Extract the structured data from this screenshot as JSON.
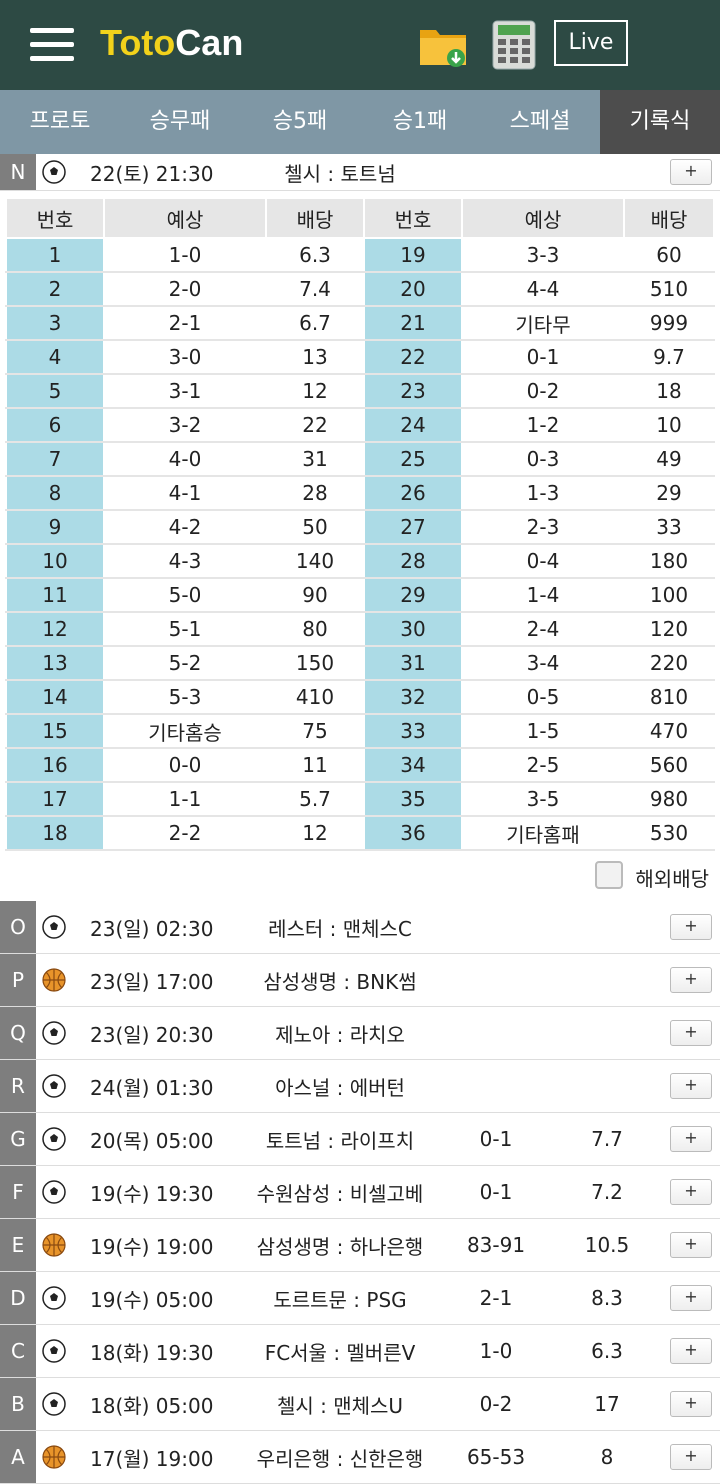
{
  "header": {
    "logo_part1": "Toto",
    "logo_part2": "Can",
    "live_label": "Live"
  },
  "tabs": [
    {
      "label": "프로토"
    },
    {
      "label": "승무패"
    },
    {
      "label": "승5패"
    },
    {
      "label": "승1패"
    },
    {
      "label": "스페셜"
    },
    {
      "label": "기록식"
    }
  ],
  "active_tab": "기록식",
  "expanded_match": {
    "letter": "N",
    "sport": "soccer",
    "date": "22(토) 21:30",
    "teams": "첼시 : 토트넘",
    "plus": "+"
  },
  "odds_table": {
    "headers": [
      "번호",
      "예상",
      "배당",
      "번호",
      "예상",
      "배당"
    ],
    "rows": [
      [
        "1",
        "1-0",
        "6.3",
        "19",
        "3-3",
        "60"
      ],
      [
        "2",
        "2-0",
        "7.4",
        "20",
        "4-4",
        "510"
      ],
      [
        "3",
        "2-1",
        "6.7",
        "21",
        "기타무",
        "999"
      ],
      [
        "4",
        "3-0",
        "13",
        "22",
        "0-1",
        "9.7"
      ],
      [
        "5",
        "3-1",
        "12",
        "23",
        "0-2",
        "18"
      ],
      [
        "6",
        "3-2",
        "22",
        "24",
        "1-2",
        "10"
      ],
      [
        "7",
        "4-0",
        "31",
        "25",
        "0-3",
        "49"
      ],
      [
        "8",
        "4-1",
        "28",
        "26",
        "1-3",
        "29"
      ],
      [
        "9",
        "4-2",
        "50",
        "27",
        "2-3",
        "33"
      ],
      [
        "10",
        "4-3",
        "140",
        "28",
        "0-4",
        "180"
      ],
      [
        "11",
        "5-0",
        "90",
        "29",
        "1-4",
        "100"
      ],
      [
        "12",
        "5-1",
        "80",
        "30",
        "2-4",
        "120"
      ],
      [
        "13",
        "5-2",
        "150",
        "31",
        "3-4",
        "220"
      ],
      [
        "14",
        "5-3",
        "410",
        "32",
        "0-5",
        "810"
      ],
      [
        "15",
        "기타홈승",
        "75",
        "33",
        "1-5",
        "470"
      ],
      [
        "16",
        "0-0",
        "11",
        "34",
        "2-5",
        "560"
      ],
      [
        "17",
        "1-1",
        "5.7",
        "35",
        "3-5",
        "980"
      ],
      [
        "18",
        "2-2",
        "12",
        "36",
        "기타홈패",
        "530"
      ]
    ],
    "overseas_label": "해외배당"
  },
  "matches": [
    {
      "letter": "O",
      "sport": "soccer",
      "date": "23(일) 02:30",
      "teams": "레스터 : 맨체스C",
      "score": "",
      "odds": "",
      "plus": "+"
    },
    {
      "letter": "P",
      "sport": "basketball",
      "date": "23(일) 17:00",
      "teams": "삼성생명 : BNK썸",
      "score": "",
      "odds": "",
      "plus": "+"
    },
    {
      "letter": "Q",
      "sport": "soccer",
      "date": "23(일) 20:30",
      "teams": "제노아 : 라치오",
      "score": "",
      "odds": "",
      "plus": "+"
    },
    {
      "letter": "R",
      "sport": "soccer",
      "date": "24(월) 01:30",
      "teams": "아스널 : 에버턴",
      "score": "",
      "odds": "",
      "plus": "+"
    },
    {
      "letter": "G",
      "sport": "soccer",
      "date": "20(목) 05:00",
      "teams": "토트넘 : 라이프치",
      "score": "0-1",
      "odds": "7.7",
      "plus": "+"
    },
    {
      "letter": "F",
      "sport": "soccer",
      "date": "19(수) 19:30",
      "teams": "수원삼성 : 비셀고베",
      "score": "0-1",
      "odds": "7.2",
      "plus": "+"
    },
    {
      "letter": "E",
      "sport": "basketball",
      "date": "19(수) 19:00",
      "teams": "삼성생명 : 하나은행",
      "score": "83-91",
      "odds": "10.5",
      "plus": "+"
    },
    {
      "letter": "D",
      "sport": "soccer",
      "date": "19(수) 05:00",
      "teams": "도르트문 : PSG",
      "score": "2-1",
      "odds": "8.3",
      "plus": "+"
    },
    {
      "letter": "C",
      "sport": "soccer",
      "date": "18(화) 19:30",
      "teams": "FC서울 : 멜버른V",
      "score": "1-0",
      "odds": "6.3",
      "plus": "+"
    },
    {
      "letter": "B",
      "sport": "soccer",
      "date": "18(화) 05:00",
      "teams": "첼시 : 맨체스U",
      "score": "0-2",
      "odds": "17",
      "plus": "+"
    },
    {
      "letter": "A",
      "sport": "basketball",
      "date": "17(월) 19:00",
      "teams": "우리은행 : 신한은행",
      "score": "65-53",
      "odds": "8",
      "plus": "+"
    }
  ],
  "colors": {
    "header_bg": "#2d4a44",
    "tab_bg": "#7f97a5",
    "tab_active_bg": "#4d4d4d",
    "num_cell_bg": "#acdbe6",
    "logo_yellow": "#f2d21b"
  }
}
